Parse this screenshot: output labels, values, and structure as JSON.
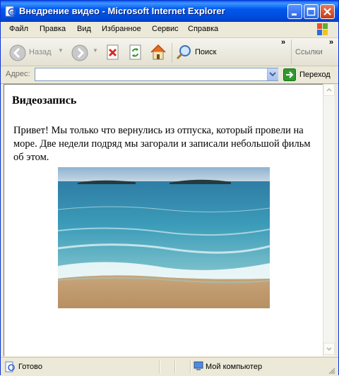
{
  "window": {
    "title": "Внедрение видео - Microsoft Internet Explorer"
  },
  "menu": [
    "Файл",
    "Правка",
    "Вид",
    "Избранное",
    "Сервис",
    "Справка"
  ],
  "toolbar": {
    "back_label": "Назад",
    "search_label": "Поиск",
    "links_label": "Ссылки"
  },
  "address": {
    "label": "Адрес:",
    "value": "",
    "go_label": "Переход"
  },
  "page": {
    "heading": "Видеозапись",
    "text": "Привет! Мы только что вернулись из отпуска, который провели на море. Две недели подряд мы загорали и записали небольшой фильм об этом."
  },
  "status": {
    "left": "Готово",
    "right": "Мой компьютер"
  },
  "colors": {
    "titlebar": "#0058ee",
    "chrome": "#ece9d8",
    "go": "#2e9a2e"
  }
}
